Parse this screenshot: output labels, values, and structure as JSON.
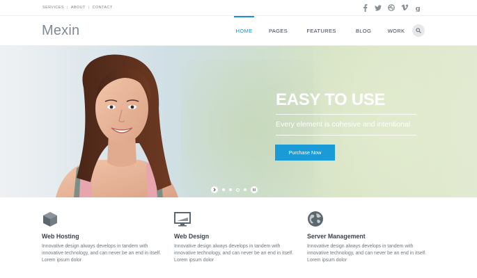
{
  "topbar": {
    "links": [
      "SERVICES",
      "ABOUT",
      "CONTACT"
    ],
    "separator": "|",
    "socials": [
      "facebook-icon",
      "twitter-icon",
      "dribbble-icon",
      "vimeo-icon",
      "google-plus-icon"
    ]
  },
  "header": {
    "logo": "Mexin",
    "nav": [
      {
        "label": "HOME",
        "active": true
      },
      {
        "label": "PAGES",
        "active": false
      },
      {
        "label": "FEATURES",
        "active": false
      },
      {
        "label": "BLOG",
        "active": false
      },
      {
        "label": "WORK",
        "active": false
      }
    ],
    "search_icon": "search-icon",
    "accent_color": "#1a8fd1"
  },
  "hero": {
    "title": "EASY TO USE",
    "subtitle": "Every element is cohesive and intentional",
    "button": "Purchase Now",
    "button_color": "#1a9ad6",
    "slides": 4,
    "active_slide": 3
  },
  "features": [
    {
      "icon": "cube-icon",
      "title": "Web Hosting",
      "text": "Innovative design always develops in tandem with innovative technology, and can never be an end in itself. Lorem ipsum dolor"
    },
    {
      "icon": "monitor-icon",
      "title": "Web Design",
      "text": "Innovative design always develops in tandem with innovative technology, and can never be an end in itself. Lorem ipsum dolor"
    },
    {
      "icon": "globe-icon",
      "title": "Server Management",
      "text": "Innovative design always develops in tandem with innovative technology, and can never be an end in itself. Lorem ipsum dolor"
    }
  ]
}
